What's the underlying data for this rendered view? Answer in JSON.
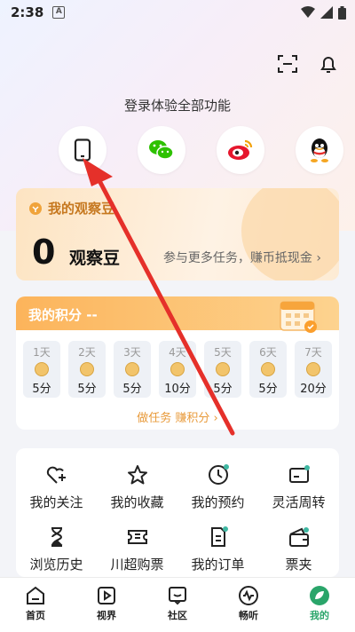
{
  "status_bar": {
    "time": "2:38",
    "a_badge": "A"
  },
  "login": {
    "prompt": "登录体验全部功能"
  },
  "bean_card": {
    "title": "我的观察豆",
    "count": "0",
    "unit": "观察豆",
    "hint": "参与更多任务，赚币抵现金 ›"
  },
  "points_card": {
    "title": "我的积分 --",
    "days": [
      {
        "label": "1天",
        "points": "5分"
      },
      {
        "label": "2天",
        "points": "5分"
      },
      {
        "label": "3天",
        "points": "5分"
      },
      {
        "label": "4天",
        "points": "10分"
      },
      {
        "label": "5天",
        "points": "5分"
      },
      {
        "label": "6天",
        "points": "5分"
      },
      {
        "label": "7天",
        "points": "20分"
      }
    ],
    "task_link": "做任务 赚积分 ›"
  },
  "menu": {
    "items": [
      {
        "label": "我的关注",
        "icon": "heart-plus-icon"
      },
      {
        "label": "我的收藏",
        "icon": "star-icon"
      },
      {
        "label": "我的预约",
        "icon": "clock-icon"
      },
      {
        "label": "灵活周转",
        "icon": "card-icon"
      },
      {
        "label": "浏览历史",
        "icon": "hourglass-icon"
      },
      {
        "label": "川超购票",
        "icon": "ticket-icon"
      },
      {
        "label": "我的订单",
        "icon": "order-icon"
      },
      {
        "label": "票夹",
        "icon": "wallet-icon"
      }
    ]
  },
  "bottom_nav": {
    "items": [
      {
        "label": "首页"
      },
      {
        "label": "视界"
      },
      {
        "label": "社区"
      },
      {
        "label": "畅听"
      },
      {
        "label": "我的"
      }
    ]
  },
  "colors": {
    "accent": "#2aa56a",
    "orange": "#f08a2c",
    "annotation": "#e5302a"
  }
}
